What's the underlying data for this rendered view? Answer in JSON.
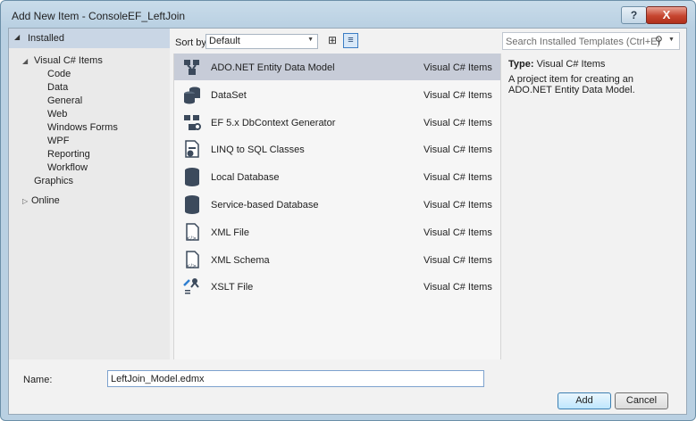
{
  "window": {
    "title": "Add New Item - ConsoleEF_LeftJoin",
    "help_label": "?",
    "close_label": "X"
  },
  "tree": {
    "installed": "Installed",
    "visual_csharp": "Visual C# Items",
    "children": [
      "Code",
      "Data",
      "General",
      "Web",
      "Windows Forms",
      "WPF",
      "Reporting",
      "Workflow"
    ],
    "graphics": "Graphics",
    "online": "Online"
  },
  "sort": {
    "label": "Sort by:",
    "value": "Default"
  },
  "items": [
    {
      "name": "ADO.NET Entity Data Model",
      "lang": "Visual C# Items",
      "icon": "entity-model-icon"
    },
    {
      "name": "DataSet",
      "lang": "Visual C# Items",
      "icon": "dataset-icon"
    },
    {
      "name": "EF 5.x DbContext Generator",
      "lang": "Visual C# Items",
      "icon": "ef-generator-icon"
    },
    {
      "name": "LINQ to SQL Classes",
      "lang": "Visual C# Items",
      "icon": "linq-icon"
    },
    {
      "name": "Local Database",
      "lang": "Visual C# Items",
      "icon": "database-icon"
    },
    {
      "name": "Service-based Database",
      "lang": "Visual C# Items",
      "icon": "database-icon"
    },
    {
      "name": "XML File",
      "lang": "Visual C# Items",
      "icon": "xml-file-icon"
    },
    {
      "name": "XML Schema",
      "lang": "Visual C# Items",
      "icon": "xml-schema-icon"
    },
    {
      "name": "XSLT File",
      "lang": "Visual C# Items",
      "icon": "xslt-icon"
    }
  ],
  "search": {
    "placeholder": "Search Installed Templates (Ctrl+E)"
  },
  "description": {
    "type_label": "Type:",
    "type_value": "Visual C# Items",
    "text": "A project item for creating an ADO.NET Entity Data Model."
  },
  "form": {
    "name_label": "Name:",
    "name_value": "LeftJoin_Model.edmx"
  },
  "buttons": {
    "add": "Add",
    "cancel": "Cancel"
  },
  "colors": {
    "selection": "#c7ccd8",
    "tree_header": "#c9d6e5",
    "window_frame": "#b9d0e2"
  }
}
